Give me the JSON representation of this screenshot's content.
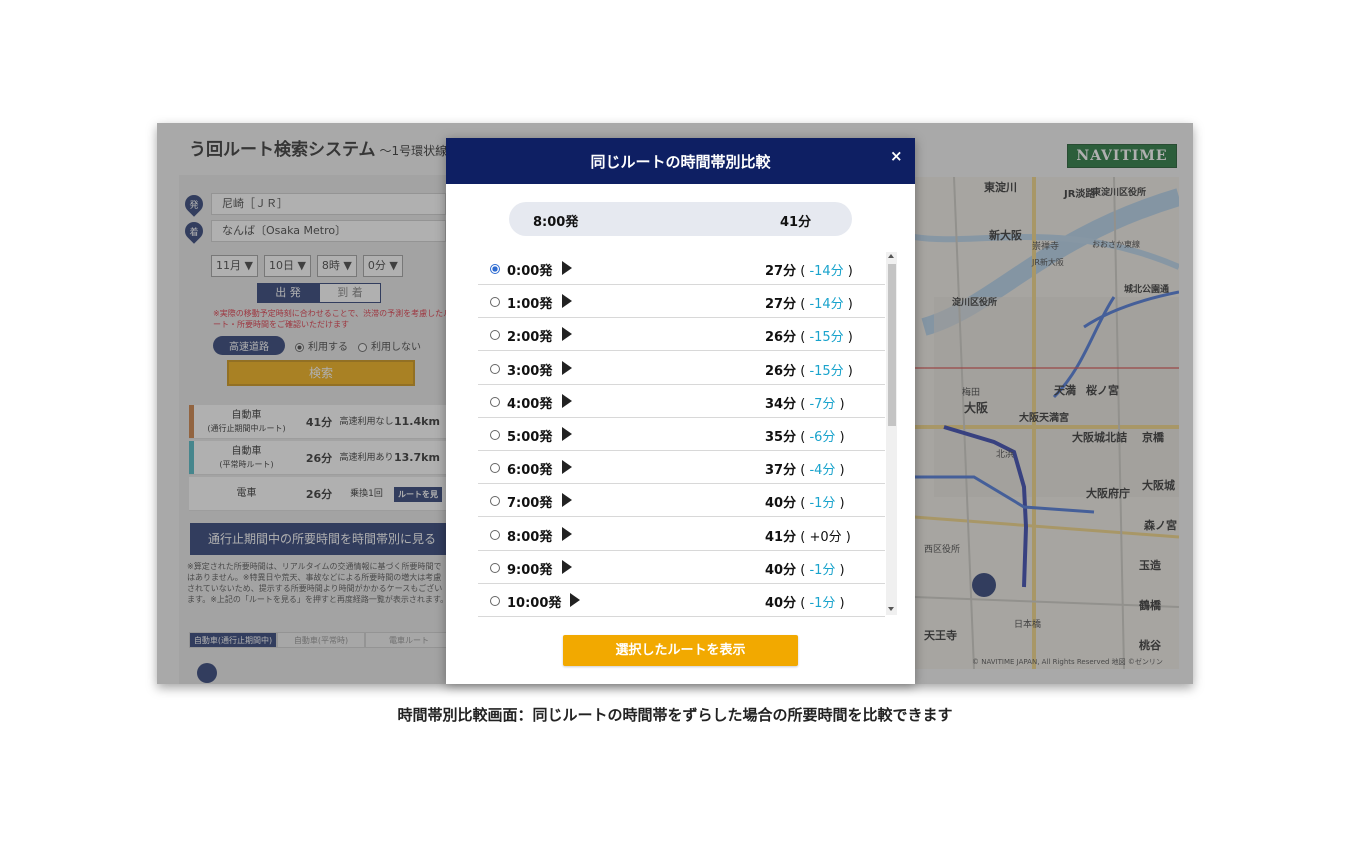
{
  "app": {
    "title": "う回ルート検索システム",
    "subtitle": "～1号環状線",
    "logo": "NAVITIME"
  },
  "search": {
    "origin_badge": "発",
    "dest_badge": "着",
    "origin": "尼崎［ＪＲ］",
    "destination": "なんば〔Osaka Metro〕",
    "month": "11月 ▼",
    "day": "10日 ▼",
    "hour": "8時 ▼",
    "minute": "0分 ▼",
    "depart_label": "出 発",
    "arrive_label": "到 着",
    "warning": "※実際の移動予定時刻に合わせることで、渋滞の予測を考慮したルート・所要時間をご確認いただけます",
    "highway_label": "高速道路",
    "use_label": "利用する",
    "nouse_label": "利用しない",
    "search_label": "検索"
  },
  "results": [
    {
      "mode": "自動車",
      "sub": "(通行止期間中ルート)",
      "time": "41分",
      "hw": "高速利用なし",
      "dist": "11.4km",
      "color": "#c87533"
    },
    {
      "mode": "自動車",
      "sub": "(平常時ルート)",
      "time": "26分",
      "hw": "高速利用あり",
      "dist": "13.7km",
      "color": "#3fb2bf"
    },
    {
      "mode": "電車",
      "sub": "",
      "time": "26分",
      "hw": "乗換1回",
      "dist": "ルートを見",
      "color": "#ffffff"
    }
  ],
  "period_button": "通行止期間中の所要時間を時間帯別に見る",
  "notes": "※算定された所要時間は、リアルタイムの交通情報に基づく所要時間ではありません。※特異日や荒天、事故などによる所要時間の増大は考慮されていないため、提示する所要時間より時間がかかるケースもございます。※上記の「ルートを見る」を押すと再度経路一覧が表示されます。",
  "mini_tabs": [
    "自動車(通行止期間中)",
    "自動車(平常時)",
    "電車ルート"
  ],
  "map": {
    "labels": [
      "東淀川",
      "JR淡路",
      "東淀川区役所",
      "新大阪",
      "崇禅寺",
      "おおさか東線",
      "JR新大阪",
      "淀川区役所",
      "城北公園通",
      "梅田",
      "大阪",
      "天満",
      "桜ノ宮",
      "大阪天満宮",
      "大阪城北詰",
      "京橋",
      "北浜",
      "大阪府庁",
      "大阪城",
      "森ノ宮",
      "西区役所",
      "玉造",
      "鶴橋",
      "桃谷",
      "日本橋",
      "天王寺"
    ],
    "copyright": "© NAVITIME JAPAN, All Rights Reserved 地図 ©ゼンリン"
  },
  "modal": {
    "title": "同じルートの時間帯別比較",
    "close": "×",
    "current_time": "8:00発",
    "current_duration": "41分",
    "button": "選択したルートを表示",
    "rows": [
      {
        "time": "0:00発",
        "duration": "27分",
        "diff": "-14分",
        "selected": true
      },
      {
        "time": "1:00発",
        "duration": "27分",
        "diff": "-14分",
        "selected": false
      },
      {
        "time": "2:00発",
        "duration": "26分",
        "diff": "-15分",
        "selected": false
      },
      {
        "time": "3:00発",
        "duration": "26分",
        "diff": "-15分",
        "selected": false
      },
      {
        "time": "4:00発",
        "duration": "34分",
        "diff": "-7分",
        "selected": false
      },
      {
        "time": "5:00発",
        "duration": "35分",
        "diff": "-6分",
        "selected": false
      },
      {
        "time": "6:00発",
        "duration": "37分",
        "diff": "-4分",
        "selected": false
      },
      {
        "time": "7:00発",
        "duration": "40分",
        "diff": "-1分",
        "selected": false
      },
      {
        "time": "8:00発",
        "duration": "41分",
        "diff": "+0分",
        "selected": false
      },
      {
        "time": "9:00発",
        "duration": "40分",
        "diff": "-1分",
        "selected": false
      },
      {
        "time": "10:00発",
        "duration": "40分",
        "diff": "-1分",
        "selected": false
      }
    ]
  },
  "caption": "時間帯別比較画面：同じルートの時間帯をずらした場合の所要時間を比較できます"
}
